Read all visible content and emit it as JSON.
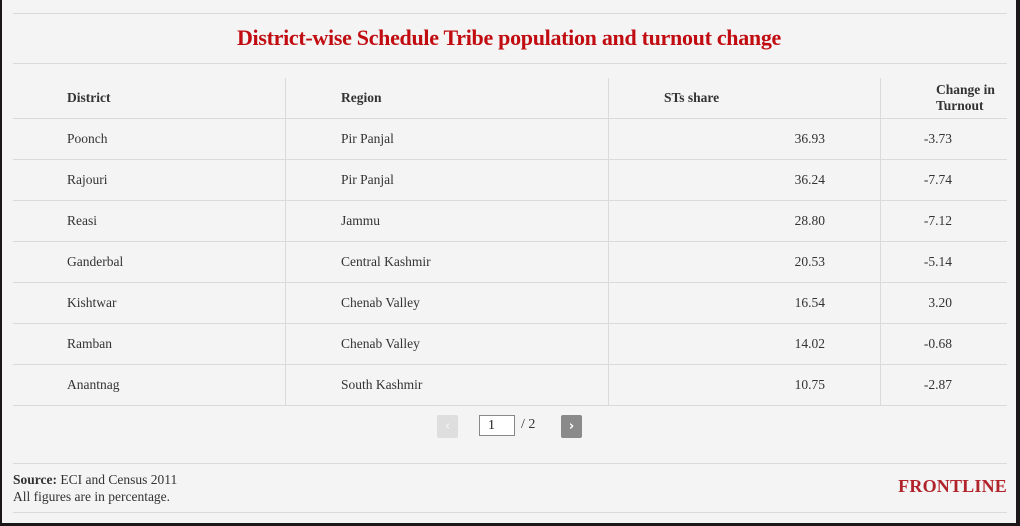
{
  "title": "District-wise Schedule Tribe population and turnout change",
  "table": {
    "headers": [
      "District",
      "Region",
      "STs share",
      "Change in Turnout"
    ],
    "rows": [
      [
        "Poonch",
        "Pir Panjal",
        "36.93",
        "-3.73"
      ],
      [
        "Rajouri",
        "Pir Panjal",
        "36.24",
        "-7.74"
      ],
      [
        "Reasi",
        "Jammu",
        "28.80",
        "-7.12"
      ],
      [
        "Ganderbal",
        "Central Kashmir",
        "20.53",
        "-5.14"
      ],
      [
        "Kishtwar",
        "Chenab Valley",
        "16.54",
        "3.20"
      ],
      [
        "Ramban",
        "Chenab Valley",
        "14.02",
        "-0.68"
      ],
      [
        "Anantnag",
        "South Kashmir",
        "10.75",
        "-2.87"
      ]
    ]
  },
  "pagination": {
    "prev_icon": "‹",
    "next_icon": "›",
    "current_page": "1",
    "total_label": "/ 2"
  },
  "footer": {
    "source_label": "Source:",
    "source_text": " ECI and Census 2011",
    "note": "All figures are in percentage.",
    "brand": "FRONTLINE"
  },
  "colors": {
    "title": "#c10d12",
    "brand": "#b0232a",
    "background": "#f4f4f4"
  }
}
